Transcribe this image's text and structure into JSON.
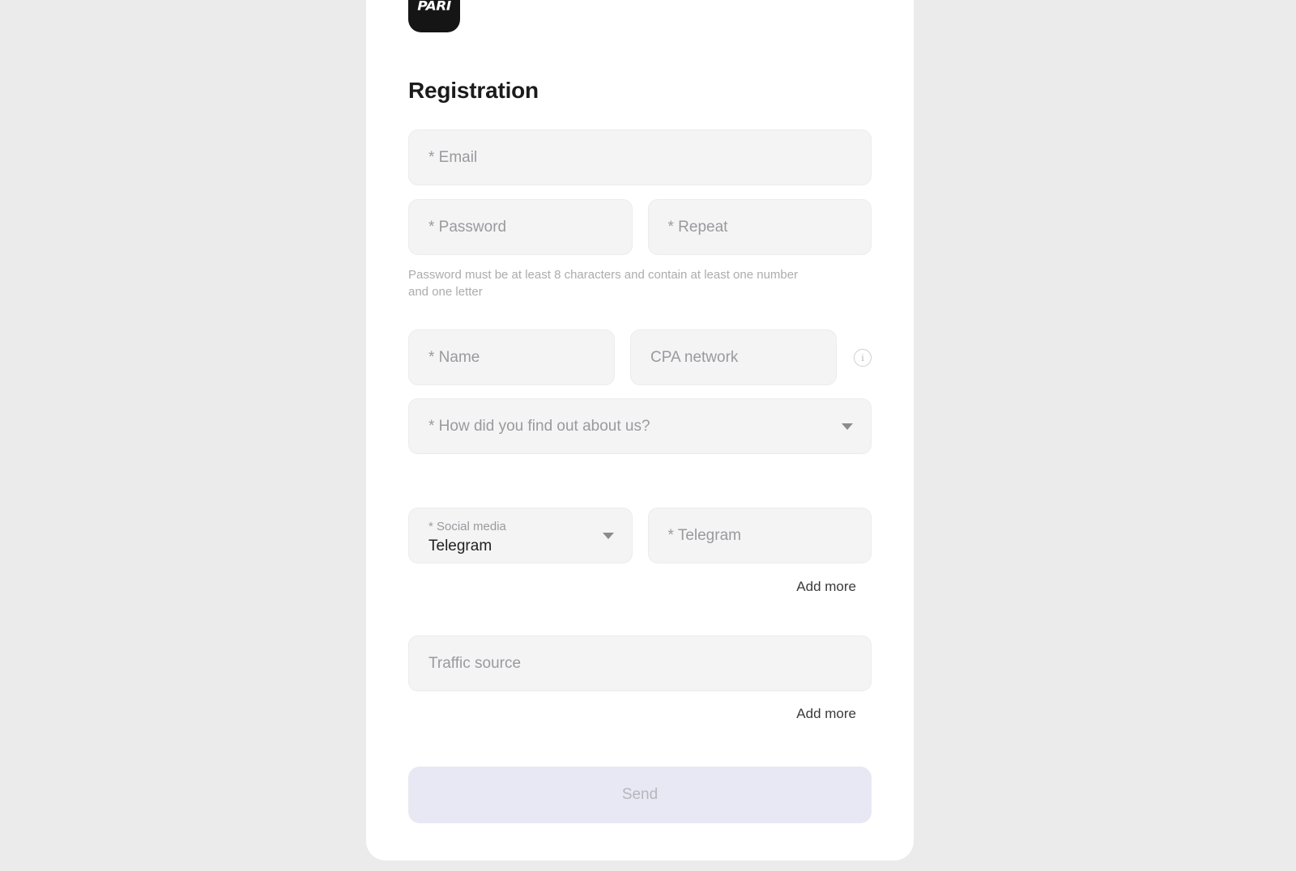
{
  "theme": {
    "page_background": "#ebebec",
    "card_background": "#ffffff",
    "field_background": "#f4f4f5",
    "accent_button_background": "#e8e8f4",
    "text_primary": "#1b1b1b",
    "text_placeholder": "#9a9a9e"
  },
  "brand": {
    "logo_text": "PARI",
    "logo_icon": "pari-logo-icon"
  },
  "page": {
    "title": "Registration"
  },
  "form": {
    "email": {
      "placeholder": "* Email",
      "value": ""
    },
    "password": {
      "placeholder": "* Password",
      "value": ""
    },
    "repeat_password": {
      "placeholder": "* Repeat",
      "value": ""
    },
    "password_hint": "Password must be at least 8 characters and contain at least one number and one letter",
    "name": {
      "placeholder": "* Name",
      "value": ""
    },
    "cpa_network": {
      "placeholder": "CPA network",
      "value": "",
      "info_icon": "info-circle-icon"
    },
    "how_found": {
      "placeholder": "* How did you find out about us?",
      "value": "",
      "caret_icon": "chevron-down-icon"
    },
    "social_media": {
      "label": "* Social media",
      "value": "Telegram",
      "caret_icon": "chevron-down-icon"
    },
    "social_contact": {
      "placeholder": "* Telegram",
      "value": ""
    },
    "social_add_more": "Add more",
    "traffic_source": {
      "placeholder": "Traffic source",
      "value": ""
    },
    "traffic_add_more": "Add more",
    "submit": {
      "label": "Send",
      "disabled": true
    }
  }
}
